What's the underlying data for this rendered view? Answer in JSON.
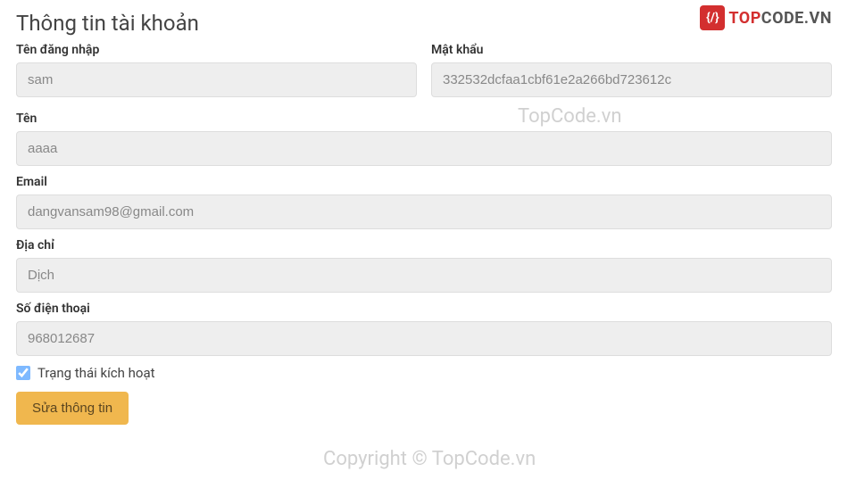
{
  "logo": {
    "icon_text": "{/}",
    "text_top": "TOP",
    "text_code": "CODE.VN"
  },
  "page": {
    "title": "Thông tin tài khoản"
  },
  "form": {
    "username": {
      "label": "Tên đăng nhập",
      "value": "sam"
    },
    "password": {
      "label": "Mật khẩu",
      "value": "332532dcfaa1cbf61e2a266bd723612c"
    },
    "name": {
      "label": "Tên",
      "value": "aaaa"
    },
    "email": {
      "label": "Email",
      "value": "dangvansam98@gmail.com"
    },
    "address": {
      "label": "Địa chỉ",
      "value": "Dịch"
    },
    "phone": {
      "label": "Số điện thoại",
      "value": "968012687"
    },
    "active_status": {
      "label": "Trạng thái kích hoạt",
      "checked": true
    },
    "submit_label": "Sửa thông tin"
  },
  "watermarks": {
    "w1": "TopCode.vn",
    "w2": "Copyright © TopCode.vn"
  }
}
